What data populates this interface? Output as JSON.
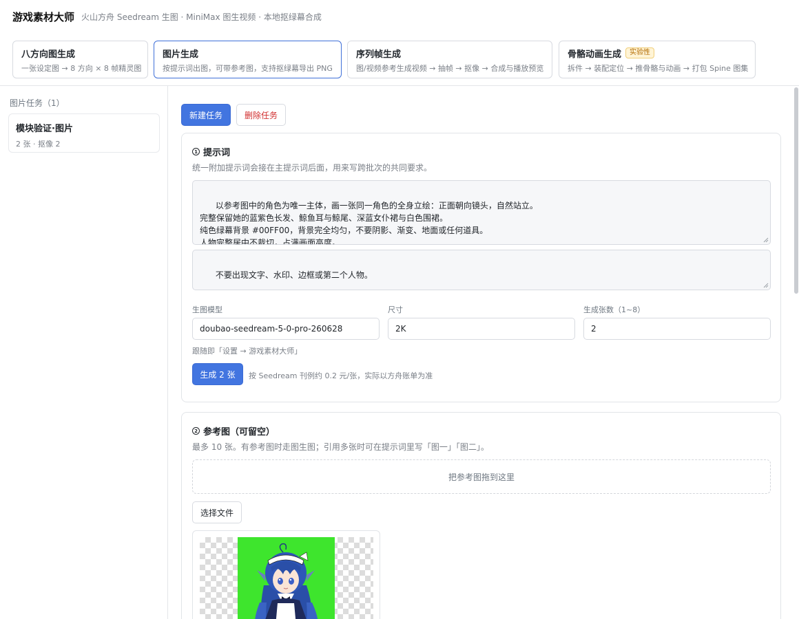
{
  "header": {
    "title": "游戏素材大师",
    "subtitle": "火山方舟 Seedream 生图 · MiniMax 图生视频 · 本地抠绿幕合成"
  },
  "modes": [
    {
      "title": "八方向图生成",
      "desc": "一张设定图 → 8 方向 × 8 帧精灵图"
    },
    {
      "title": "图片生成",
      "desc": "按提示词出图，可带参考图，支持抠绿幕导出 PNG"
    },
    {
      "title": "序列帧生成",
      "desc": "图/视频参考生成视频 → 抽帧 → 抠像 → 合成与播放预览"
    },
    {
      "title": "骨骼动画生成",
      "badge": "实验性",
      "desc": "拆件 → 装配定位 → 推骨骼与动画 → 打包 Spine 图集"
    }
  ],
  "sidebar": {
    "header": "图片任务（1）",
    "tasks": [
      {
        "name": "模块验证·图片",
        "meta": "2 张 · 抠像 2"
      }
    ]
  },
  "toolbar": {
    "new_task": "新建任务",
    "delete_task": "删除任务"
  },
  "prompt_panel": {
    "number": "1",
    "title": "提示词",
    "hint": "统一附加提示词会接在主提示词后面，用来写跨批次的共同要求。",
    "main_prompt": "以参考图中的角色为唯一主体，画一张同一角色的全身立绘：正面朝向镜头，自然站立。\n完整保留她的蓝紫色长发、鲸鱼耳与鲸尾、深蓝女仆裙与白色围裙。\n纯色绿幕背景 #00FF00，背景完全均匀，不要阴影、渐变、地面或任何道具。\n人物完整居中不裁切，占满画面高度。",
    "extra_prompt": "不要出现文字、水印、边框或第二个人物。",
    "model_label": "生图模型",
    "model_value": "doubao-seedream-5-0-pro-260628",
    "size_label": "尺寸",
    "size_value": "2K",
    "count_label": "生成张数（1~8）",
    "count_value": "2",
    "follow_note": "跟随即「设置 → 游戏素材大师」",
    "generate_button": "生成 2 张",
    "price_note": "按 Seedream 刊例约 0.2 元/张，实际以方舟账单为准"
  },
  "reference_panel": {
    "number": "2",
    "title": "参考图（可留空）",
    "hint": "最多 10 张。有参考图时走图生图；引用多张时可在提示词里写「图一」「图二」。",
    "dropzone": "把参考图拖到这里",
    "choose_file": "选择文件"
  },
  "colors": {
    "accent": "#4275e0",
    "danger": "#d12f2f",
    "greenscreen": "#3ee52d",
    "badge_bg": "#fff4d6"
  }
}
